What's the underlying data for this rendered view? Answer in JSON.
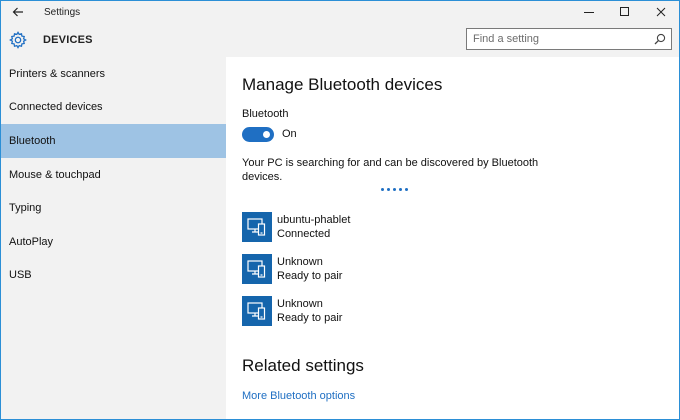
{
  "window": {
    "title": "Settings",
    "back_icon": "back-arrow-icon",
    "controls": {
      "minimize": "—",
      "maximize": "☐",
      "close": "✕"
    }
  },
  "header": {
    "title": "DEVICES",
    "icon": "gear-icon",
    "search_placeholder": "Find a setting"
  },
  "sidebar": {
    "items": [
      {
        "label": "Printers & scanners",
        "active": false
      },
      {
        "label": "Connected devices",
        "active": false
      },
      {
        "label": "Bluetooth",
        "active": true
      },
      {
        "label": "Mouse & touchpad",
        "active": false
      },
      {
        "label": "Typing",
        "active": false
      },
      {
        "label": "AutoPlay",
        "active": false
      },
      {
        "label": "USB",
        "active": false
      }
    ]
  },
  "main": {
    "title": "Manage Bluetooth devices",
    "bluetooth_label": "Bluetooth",
    "bluetooth_state": "On",
    "bluetooth_on": true,
    "status_text": "Your PC is searching for and can be discovered by Bluetooth devices.",
    "devices": [
      {
        "name": "ubuntu-phablet",
        "status": "Connected",
        "icon": "device-icon"
      },
      {
        "name": "Unknown",
        "status": "Ready to pair",
        "icon": "device-icon"
      },
      {
        "name": "Unknown",
        "status": "Ready to pair",
        "icon": "device-icon"
      }
    ],
    "related_title": "Related settings",
    "related_link": "More Bluetooth options"
  },
  "colors": {
    "accent": "#1f6fc3",
    "sidebar_active": "#9ec3e4",
    "chrome": "#f2f2f2",
    "device_tile": "#1565ac"
  }
}
